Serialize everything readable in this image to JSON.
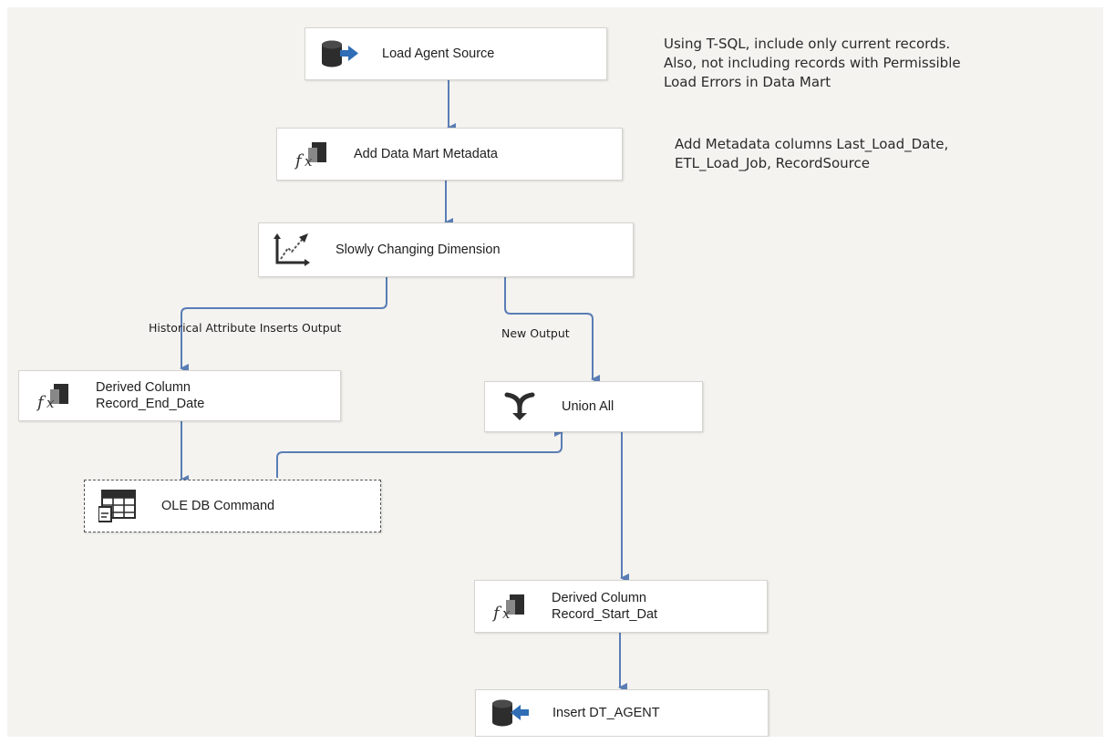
{
  "canvas": {
    "background": "#f4f3f0",
    "connector_color": "#5a7db5"
  },
  "nodes": {
    "load_agent_source": {
      "label": "Load Agent Source",
      "icon": "database-source-icon"
    },
    "add_metadata": {
      "label": "Add Data Mart Metadata",
      "icon": "fx-derived-column-icon"
    },
    "scd": {
      "label": "Slowly Changing Dimension",
      "icon": "slowly-changing-dimension-icon"
    },
    "derived_end": {
      "label_line1": "Derived Column",
      "label_line2": "Record_End_Date",
      "icon": "fx-derived-column-icon"
    },
    "union_all": {
      "label": "Union All",
      "icon": "union-all-icon"
    },
    "ole_db": {
      "label": "OLE DB Command",
      "icon": "ole-db-command-icon"
    },
    "derived_start": {
      "label_line1": "Derived Column",
      "label_line2": "Record_Start_Dat",
      "icon": "fx-derived-column-icon"
    },
    "insert_agent": {
      "label": "Insert DT_AGENT",
      "icon": "database-destination-icon"
    }
  },
  "path_labels": {
    "historical": "Historical Attribute Inserts Output",
    "new_output": "New Output"
  },
  "annotations": {
    "note1": {
      "line1": "Using T-SQL, include only current records.",
      "line2": "Also, not including records with Permissible",
      "line3": "Load Errors in Data Mart"
    },
    "note2": {
      "line1": "Add Metadata columns Last_Load_Date,",
      "line2": "ETL_Load_Job, RecordSource"
    }
  }
}
